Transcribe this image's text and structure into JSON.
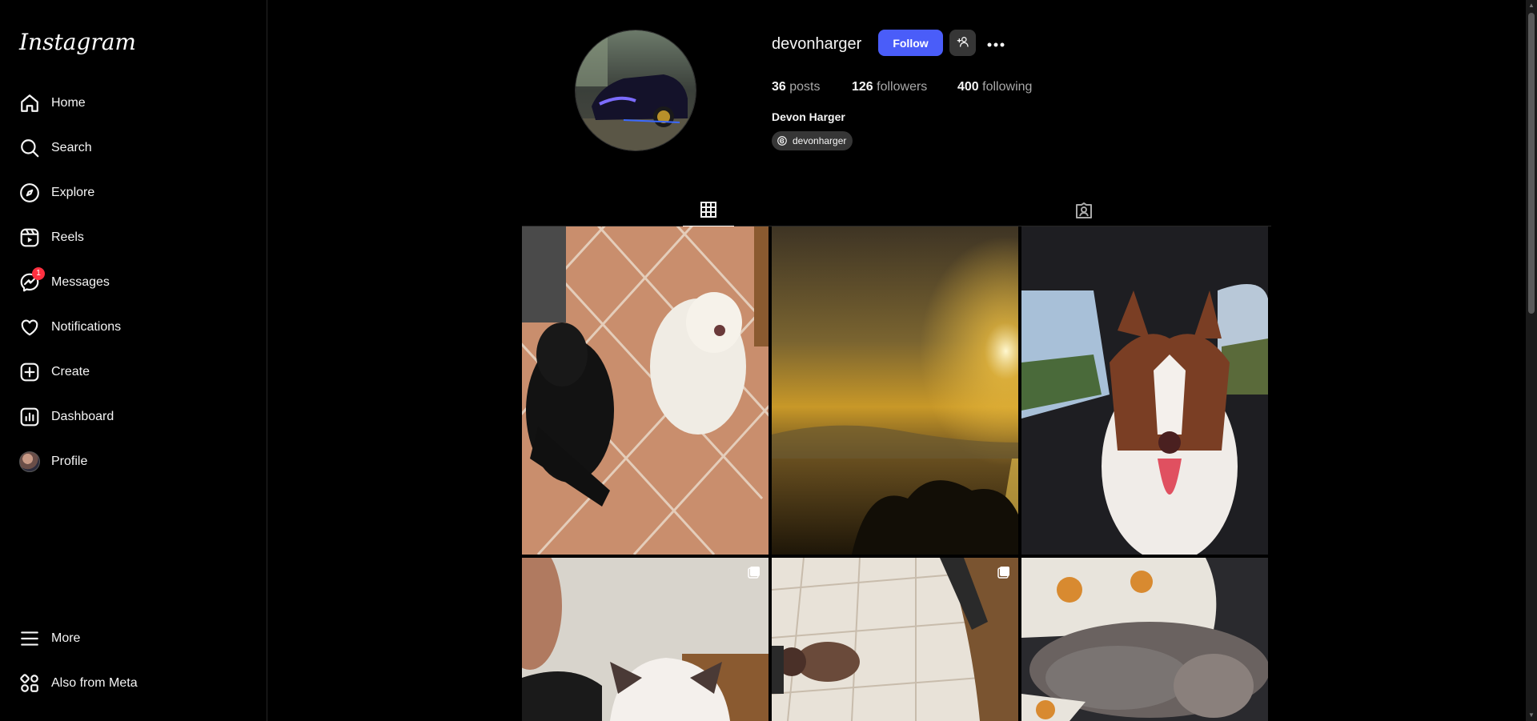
{
  "app": {
    "logo_text": "Instagram"
  },
  "sidebar": {
    "items": [
      {
        "label": "Home",
        "icon": "home-icon"
      },
      {
        "label": "Search",
        "icon": "search-icon"
      },
      {
        "label": "Explore",
        "icon": "compass-icon"
      },
      {
        "label": "Reels",
        "icon": "reels-icon"
      },
      {
        "label": "Messages",
        "icon": "messenger-icon",
        "badge": "1"
      },
      {
        "label": "Notifications",
        "icon": "heart-icon"
      },
      {
        "label": "Create",
        "icon": "plus-square-icon"
      },
      {
        "label": "Dashboard",
        "icon": "chart-icon"
      },
      {
        "label": "Profile",
        "icon": "avatar"
      }
    ],
    "bottom": [
      {
        "label": "More",
        "icon": "menu-icon"
      },
      {
        "label": "Also from Meta",
        "icon": "meta-apps-icon"
      }
    ]
  },
  "profile": {
    "username": "devonharger",
    "follow_label": "Follow",
    "stats": {
      "posts_count": "36",
      "posts_label": "posts",
      "followers_count": "126",
      "followers_label": "followers",
      "following_count": "400",
      "following_label": "following"
    },
    "full_name": "Devon Harger",
    "threads_handle": "devonharger"
  },
  "tabs": [
    {
      "name": "posts",
      "icon": "grid-icon",
      "active": true
    },
    {
      "name": "tagged",
      "icon": "tagged-user-icon",
      "active": false
    }
  ],
  "posts": [
    {
      "subject": "two dogs on tile floor"
    },
    {
      "subject": "sunset over water"
    },
    {
      "subject": "husky in car"
    },
    {
      "subject": "selfie with husky",
      "multi": true
    },
    {
      "subject": "puppy on tile floor",
      "multi": true
    },
    {
      "subject": "puppy sleeping on blanket"
    }
  ],
  "colors": {
    "accent": "#4a5df9",
    "badge": "#ff3040",
    "background": "#000000"
  }
}
